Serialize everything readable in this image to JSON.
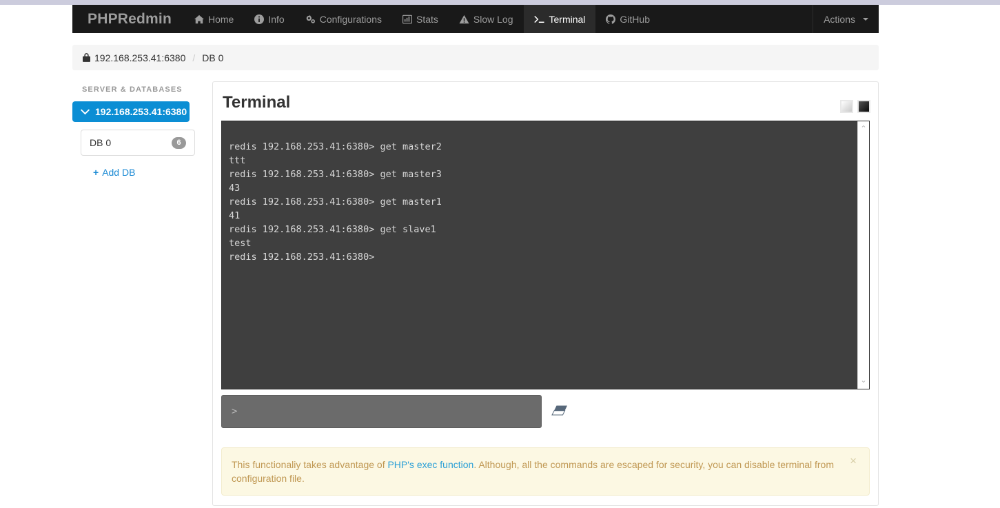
{
  "brand": "PHPRedmin",
  "nav": {
    "items": [
      {
        "label": "Home",
        "icon": "home-icon",
        "active": false
      },
      {
        "label": "Info",
        "icon": "info-circle-icon",
        "active": false
      },
      {
        "label": "Configurations",
        "icon": "gears-icon",
        "active": false
      },
      {
        "label": "Stats",
        "icon": "bar-chart-icon",
        "active": false
      },
      {
        "label": "Slow Log",
        "icon": "warning-triangle-icon",
        "active": false
      },
      {
        "label": "Terminal",
        "icon": "terminal-prompt-icon",
        "active": true
      },
      {
        "label": "GitHub",
        "icon": "github-icon",
        "active": false
      }
    ],
    "actions_label": "Actions"
  },
  "breadcrumb": {
    "server": "192.168.253.41:6380",
    "separator": "/",
    "current": "DB 0",
    "lock_icon": "lock-icon"
  },
  "sidebar": {
    "title": "SERVER & DATABASES",
    "server": {
      "label": "192.168.253.41:6380",
      "icon": "chevron-down-icon"
    },
    "databases": [
      {
        "label": "DB 0",
        "badge": "6"
      }
    ],
    "add_db": {
      "label": "Add DB",
      "icon": "plus-icon",
      "plus": "+"
    }
  },
  "panel": {
    "title": "Terminal",
    "theme_toggles": [
      {
        "name": "light-theme-swatch"
      },
      {
        "name": "dark-theme-swatch"
      }
    ]
  },
  "terminal": {
    "output": "redis 192.168.253.41:6380> get master2\nttt\nredis 192.168.253.41:6380> get master3\n43\nredis 192.168.253.41:6380> get master1\n41\nredis 192.168.253.41:6380> get slave1\ntest\nredis 192.168.253.41:6380>",
    "scroll_up": "⌃",
    "scroll_down": "⌄",
    "input_prompt": ">",
    "input_value": "",
    "input_placeholder": "",
    "clear_button_icon": "eraser-icon"
  },
  "alert": {
    "text_before": "This functionaliy takes advantage of ",
    "link": "PHP's exec function",
    "text_after": ". Although, all the commands are escaped for security, you can disable terminal from configuration file.",
    "close": "×"
  },
  "colors": {
    "navbar_bg": "#191919",
    "nav_active_bg": "#2b2b2b",
    "accent_blue": "#0b8ed4",
    "link_blue": "#2a9fd6",
    "terminal_bg": "#3f3f3f",
    "terminal_text": "#d8d8d8",
    "input_bg": "#6b6b6b",
    "alert_bg": "#fcf8e3",
    "alert_text": "#c09853",
    "top_strip": "#ccccdd"
  }
}
